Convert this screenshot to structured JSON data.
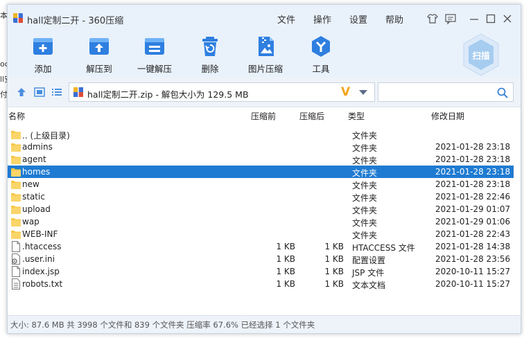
{
  "background": {
    "fragments": [
      "本",
      "oc",
      "ll安",
      "付"
    ]
  },
  "window": {
    "title": "hall定制二开 - 360压缩"
  },
  "menu": [
    "文件",
    "操作",
    "设置",
    "帮助"
  ],
  "toolbar": [
    {
      "label": "添加",
      "icon": "add-icon"
    },
    {
      "label": "解压到",
      "icon": "extract-to-icon"
    },
    {
      "label": "一键解压",
      "icon": "one-click-extract-icon"
    },
    {
      "label": "删除",
      "icon": "delete-icon"
    },
    {
      "label": "图片压缩",
      "icon": "image-compress-icon"
    },
    {
      "label": "工具",
      "icon": "tools-icon"
    }
  ],
  "scan": {
    "label": "扫描"
  },
  "address": {
    "path": "hall定制二开.zip - 解包大小为 129.5 MB",
    "badge": "V"
  },
  "search": {
    "placeholder": ""
  },
  "columns": [
    "名称",
    "压缩前",
    "压缩后",
    "类型",
    "修改日期"
  ],
  "files": [
    {
      "name": ".. (上级目录)",
      "before": "",
      "after": "",
      "type": "文件夹",
      "date": "",
      "kind": "folder"
    },
    {
      "name": "admins",
      "before": "",
      "after": "",
      "type": "文件夹",
      "date": "2021-01-28 23:18",
      "kind": "folder"
    },
    {
      "name": "agent",
      "before": "",
      "after": "",
      "type": "文件夹",
      "date": "2021-01-28 23:18",
      "kind": "folder"
    },
    {
      "name": "homes",
      "before": "",
      "after": "",
      "type": "文件夹",
      "date": "2021-01-28 23:18",
      "kind": "folder",
      "selected": true
    },
    {
      "name": "new",
      "before": "",
      "after": "",
      "type": "文件夹",
      "date": "2021-01-28 23:18",
      "kind": "folder"
    },
    {
      "name": "static",
      "before": "",
      "after": "",
      "type": "文件夹",
      "date": "2021-01-28 22:46",
      "kind": "folder"
    },
    {
      "name": "upload",
      "before": "",
      "after": "",
      "type": "文件夹",
      "date": "2021-01-29 01:07",
      "kind": "folder"
    },
    {
      "name": "wap",
      "before": "",
      "after": "",
      "type": "文件夹",
      "date": "2021-01-29 01:06",
      "kind": "folder"
    },
    {
      "name": "WEB-INF",
      "before": "",
      "after": "",
      "type": "文件夹",
      "date": "2021-01-28 22:43",
      "kind": "folder"
    },
    {
      "name": ".htaccess",
      "before": "1 KB",
      "after": "1 KB",
      "type": "HTACCESS 文件",
      "date": "2021-01-28 14:38",
      "kind": "file"
    },
    {
      "name": ".user.ini",
      "before": "1 KB",
      "after": "1 KB",
      "type": "配置设置",
      "date": "2021-01-28 23:56",
      "kind": "config"
    },
    {
      "name": "index.jsp",
      "before": "1 KB",
      "after": "1 KB",
      "type": "JSP 文件",
      "date": "2020-10-11 15:27",
      "kind": "file"
    },
    {
      "name": "robots.txt",
      "before": "1 KB",
      "after": "1 KB",
      "type": "文本文档",
      "date": "2020-10-11 15:27",
      "kind": "text"
    }
  ],
  "status": {
    "text": "大小: 87.6 MB 共 3998 个文件和 839 个文件夹 压缩率 67.6% 已经选择 1 个文件夹"
  },
  "colors": {
    "accent": "#1e7bd1",
    "toolbar_bg": "#e9f1fb",
    "folder": "#f7c948",
    "badge": "#f2a51c"
  }
}
